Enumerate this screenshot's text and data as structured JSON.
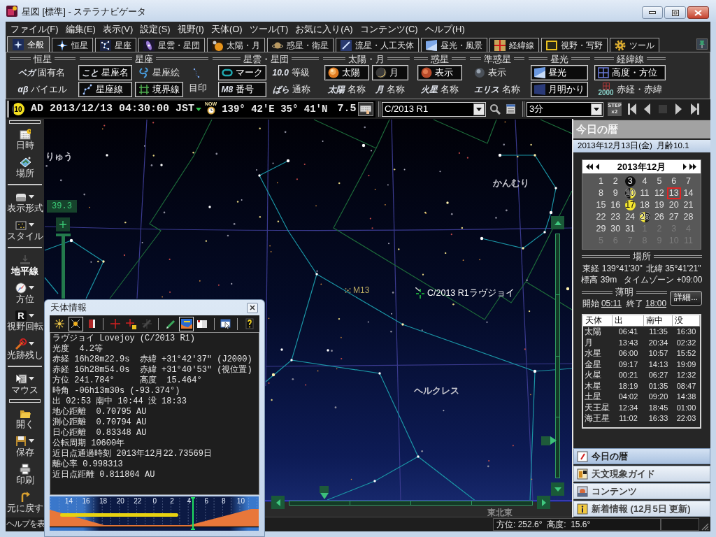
{
  "window": {
    "title": "星図 [標準] - ステラナビゲータ"
  },
  "menu": [
    "ファイル(F)",
    "編集(E)",
    "表示(V)",
    "設定(S)",
    "視野(I)",
    "天体(O)",
    "ツール(T)",
    "お気に入り(A)",
    "コンテンツ(C)",
    "ヘルプ(H)"
  ],
  "tabs": [
    {
      "label": "全般",
      "selected": true
    },
    {
      "label": "恒星",
      "selected": false
    },
    {
      "label": "星座",
      "selected": false
    },
    {
      "label": "星雲・星団",
      "selected": false
    },
    {
      "label": "太陽・月",
      "selected": false
    },
    {
      "label": "惑星・衛星",
      "selected": false
    },
    {
      "label": "流星・人工天体",
      "selected": false
    },
    {
      "label": "昼光・風景",
      "selected": false
    },
    {
      "label": "経緯線",
      "selected": false
    },
    {
      "label": "視野・写野",
      "selected": false
    },
    {
      "label": "ツール",
      "selected": false
    }
  ],
  "display_groups": [
    {
      "title": "恒星",
      "columns": [
        [
          {
            "label": "固有名",
            "icon_text": "ベガ",
            "kind": "inline",
            "on": false
          },
          {
            "label": "バイエル",
            "icon_text": "αβ",
            "kind": "inline",
            "on": false
          }
        ]
      ]
    },
    {
      "title": "星座",
      "columns": [
        [
          {
            "label": "星座名",
            "icon_text": "こと",
            "kind": "inline",
            "on": true
          },
          {
            "label": "星座線",
            "kind": "inline",
            "on": true
          }
        ],
        [
          {
            "label": "星座絵",
            "kind": "inline",
            "on": false
          },
          {
            "label": "境界線",
            "kind": "inline",
            "on": true
          }
        ],
        [
          {
            "label": "目印",
            "kind": "stacked",
            "on": false
          }
        ]
      ]
    },
    {
      "title": "星雲・星団",
      "columns": [
        [
          {
            "label": "マーク",
            "kind": "inline",
            "on": true
          },
          {
            "label": "番号",
            "icon_text": "M8",
            "kind": "inline",
            "on": true
          }
        ],
        [
          {
            "label": "等級",
            "icon_text": "10.0",
            "kind": "inline",
            "on": false
          },
          {
            "label": "通称",
            "icon_text": "ばら",
            "kind": "inline",
            "on": false
          }
        ]
      ]
    },
    {
      "title": "太陽・月",
      "columns": [
        [
          {
            "label": "太陽",
            "kind": "inline",
            "on": true
          },
          {
            "label": "名称",
            "icon_text": "太陽",
            "kind": "inline",
            "on": false
          }
        ],
        [
          {
            "label": "月",
            "kind": "inline",
            "on": true
          },
          {
            "label": "名称",
            "icon_text": "月",
            "kind": "inline",
            "on": false
          }
        ]
      ]
    },
    {
      "title": "惑星",
      "columns": [
        [
          {
            "label": "表示",
            "kind": "inline",
            "on": true
          },
          {
            "label": "名称",
            "icon_text": "火星",
            "kind": "inline",
            "on": false
          }
        ]
      ]
    },
    {
      "title": "準惑星",
      "columns": [
        [
          {
            "label": "表示",
            "kind": "inline",
            "on": false
          },
          {
            "label": "名称",
            "icon_text": "エリス",
            "kind": "inline",
            "on": false
          }
        ]
      ]
    },
    {
      "title": "昼光",
      "columns": [
        [
          {
            "label": "昼光",
            "kind": "inline",
            "on": true
          },
          {
            "label": "月明かり",
            "kind": "inline",
            "on": true
          }
        ]
      ]
    },
    {
      "title": "経緯線",
      "columns": [
        [
          {
            "label": "高度・方位",
            "kind": "inline",
            "on": true
          },
          {
            "label": "赤経・赤緯",
            "icon_text": "2000",
            "kind": "inline",
            "on": false
          }
        ]
      ]
    }
  ],
  "time_bar": {
    "moon_age": "10",
    "datetime": "AD 2013/12/13 04:30:00 JST",
    "now_label": "NOW",
    "coordinates": "139° 42'E 35° 41'N",
    "readout": "7.5",
    "target": "C/2013 R1",
    "step": "3分",
    "step_label": "STEP",
    "step_multiplier": "x2"
  },
  "sidebar": {
    "toolbars": [
      {
        "groups": [
          [
            {
              "label": "日時",
              "has_menu": false,
              "on": false
            },
            {
              "label": "場所",
              "has_menu": false,
              "on": false
            }
          ],
          [
            {
              "label": "表示形式",
              "has_menu": true,
              "on": false
            },
            {
              "label": "スタイル",
              "has_menu": true,
              "on": false
            }
          ],
          [
            {
              "label": "地平線",
              "has_menu": false,
              "on": true
            },
            {
              "label": "方位",
              "has_menu": true,
              "on": false
            },
            {
              "label": "視野回転",
              "has_menu": true,
              "on": false,
              "icon_text": "R"
            },
            {
              "label": "光跡残し",
              "has_menu": true,
              "on": false
            }
          ],
          [
            {
              "label": "マウス",
              "has_menu": true,
              "on": false
            }
          ]
        ]
      },
      {
        "groups": [
          [
            {
              "label": "開く",
              "has_menu": false,
              "on": false
            },
            {
              "label": "保存",
              "has_menu": true,
              "on": false
            },
            {
              "label": "印刷",
              "has_menu": false,
              "on": false
            },
            {
              "label": "元に戻す",
              "has_menu": false,
              "on": false
            }
          ]
        ]
      }
    ]
  },
  "sky": {
    "labels": [
      {
        "text": "りゅう",
        "kind": "constellation"
      },
      {
        "text": "かんむり",
        "kind": "constellation"
      },
      {
        "text": "M13",
        "kind": "deep_sky"
      },
      {
        "text": "C/2013 R1ラヴジョイ",
        "kind": "target"
      },
      {
        "text": "ヘルクレス",
        "kind": "constellation"
      }
    ],
    "zoom_readout": "39.3",
    "direction": "東北東"
  },
  "info_panel": {
    "title": "天体情報",
    "tools": [
      {
        "kind": "tool",
        "selected": false,
        "disabled": false
      },
      {
        "kind": "tool",
        "selected": true,
        "disabled": false
      },
      {
        "kind": "tool",
        "selected": false,
        "disabled": false
      },
      {
        "kind": "separator"
      },
      {
        "kind": "tool",
        "selected": false,
        "disabled": false
      },
      {
        "kind": "tool",
        "selected": false,
        "disabled": false
      },
      {
        "kind": "tool",
        "selected": false,
        "disabled": true
      },
      {
        "kind": "separator"
      },
      {
        "kind": "tool",
        "selected": false,
        "disabled": false
      },
      {
        "kind": "tool",
        "selected": true,
        "disabled": false
      },
      {
        "kind": "tool",
        "selected": false,
        "disabled": false
      },
      {
        "kind": "separator"
      },
      {
        "kind": "tool",
        "selected": false,
        "disabled": false
      },
      {
        "kind": "separator"
      },
      {
        "kind": "tool",
        "selected": false,
        "disabled": false
      }
    ],
    "lines": [
      "ラヴジョイ Lovejoy (C/2013 R1)",
      "光度  4.2等",
      "赤経 16h28m22.9s  赤緯 +31°42'37\" (J2000)",
      "赤経 16h28m54.0s  赤緯 +31°40'53\" (視位置)",
      "方位 241.784°     高度  15.464°",
      "時角 -06h13m30s (-93.374°)",
      "出 02:53 南中 10:44 没 18:33",
      "地心距離  0.70795 AU",
      "測心距離  0.70794 AU",
      "日心距離  0.83348 AU",
      "公転周期 10600年",
      "近日点通過時刻 2013年12月22.73569日",
      "離心率 0.998313",
      "近日点距離 0.811804 AU"
    ],
    "timeline": {
      "hour_labels": [
        "14",
        "16",
        "18",
        "20",
        "22",
        "0",
        "2",
        "4",
        "6",
        "8",
        "10"
      ]
    }
  },
  "almanac": {
    "header": "今日の暦",
    "date": "2013年12月13日(金)  月齢10.1",
    "calendar": {
      "title": "2013年12月",
      "days": [
        {
          "label": "1",
          "kind": "current",
          "selected": false
        },
        {
          "label": "2",
          "kind": "current",
          "selected": false
        },
        {
          "label": "3",
          "kind": "new_moon",
          "selected": false
        },
        {
          "label": "4",
          "kind": "current",
          "selected": false
        },
        {
          "label": "5",
          "kind": "current",
          "selected": false
        },
        {
          "label": "6",
          "kind": "current",
          "selected": false
        },
        {
          "label": "7",
          "kind": "current",
          "selected": false
        },
        {
          "label": "8",
          "kind": "current",
          "selected": false
        },
        {
          "label": "9",
          "kind": "current",
          "selected": false
        },
        {
          "label": "10",
          "kind": "first_quarter",
          "selected": false
        },
        {
          "label": "11",
          "kind": "current",
          "selected": false
        },
        {
          "label": "12",
          "kind": "current",
          "selected": false
        },
        {
          "label": "13",
          "kind": "current",
          "selected": true
        },
        {
          "label": "14",
          "kind": "current",
          "selected": false
        },
        {
          "label": "15",
          "kind": "current",
          "selected": false
        },
        {
          "label": "16",
          "kind": "current",
          "selected": false
        },
        {
          "label": "17",
          "kind": "full_moon",
          "selected": false
        },
        {
          "label": "18",
          "kind": "current",
          "selected": false
        },
        {
          "label": "19",
          "kind": "current",
          "selected": false
        },
        {
          "label": "20",
          "kind": "current",
          "selected": false
        },
        {
          "label": "21",
          "kind": "current",
          "selected": false
        },
        {
          "label": "22",
          "kind": "current",
          "selected": false
        },
        {
          "label": "23",
          "kind": "current",
          "selected": false
        },
        {
          "label": "24",
          "kind": "current",
          "selected": false
        },
        {
          "label": "25",
          "kind": "last_quarter",
          "selected": false
        },
        {
          "label": "26",
          "kind": "current",
          "selected": false
        },
        {
          "label": "27",
          "kind": "current",
          "selected": false
        },
        {
          "label": "28",
          "kind": "current",
          "selected": false
        },
        {
          "label": "29",
          "kind": "current",
          "selected": false
        },
        {
          "label": "30",
          "kind": "current",
          "selected": false
        },
        {
          "label": "31",
          "kind": "current",
          "selected": false
        },
        {
          "label": "1",
          "kind": "other",
          "selected": false
        },
        {
          "label": "2",
          "kind": "other",
          "selected": false
        },
        {
          "label": "3",
          "kind": "other",
          "selected": false
        },
        {
          "label": "4",
          "kind": "other",
          "selected": false
        },
        {
          "label": "5",
          "kind": "other",
          "selected": false
        },
        {
          "label": "6",
          "kind": "other",
          "selected": false
        },
        {
          "label": "7",
          "kind": "other",
          "selected": false
        },
        {
          "label": "8",
          "kind": "other",
          "selected": false
        },
        {
          "label": "9",
          "kind": "other",
          "selected": false
        },
        {
          "label": "10",
          "kind": "other",
          "selected": false
        },
        {
          "label": "11",
          "kind": "other",
          "selected": false
        }
      ]
    },
    "location": {
      "title": "場所",
      "longitude": "東経 139°41'30\"",
      "latitude": "北緯 35°41'21\"",
      "elevation": "標高 39m",
      "timezone": "タイムゾーン +09:00"
    },
    "twilight": {
      "title": "薄明",
      "start_label": "開始",
      "start": "05:11",
      "end_label": "終了",
      "end": "18:00",
      "details_button": "詳細..."
    },
    "table": {
      "columns": [
        "天体",
        "出",
        "南中",
        "没"
      ],
      "rows": [
        [
          "太陽",
          "06:41",
          "11:35",
          "16:30"
        ],
        [
          "月",
          "13:43",
          "20:34",
          "02:32"
        ],
        [
          "水星",
          "06:00",
          "10:57",
          "15:52"
        ],
        [
          "金星",
          "09:17",
          "14:13",
          "19:09"
        ],
        [
          "火星",
          "00:21",
          "06:27",
          "12:32"
        ],
        [
          "木星",
          "18:19",
          "01:35",
          "08:47"
        ],
        [
          "土星",
          "04:02",
          "09:20",
          "14:38"
        ],
        [
          "天王星",
          "12:34",
          "18:45",
          "01:00"
        ],
        [
          "海王星",
          "11:02",
          "16:33",
          "22:03"
        ]
      ]
    }
  },
  "panels": [
    {
      "label": "今日の暦",
      "selected": true
    },
    {
      "label": "天文現象ガイド",
      "selected": false
    },
    {
      "label": "コンテンツ",
      "selected": false
    },
    {
      "label": "新着情報 (12月5日 更新)",
      "selected": false
    }
  ],
  "status_bar": {
    "help_text": "ヘルプを表",
    "position": "方位: 252.6°  高度:  15.6°"
  }
}
